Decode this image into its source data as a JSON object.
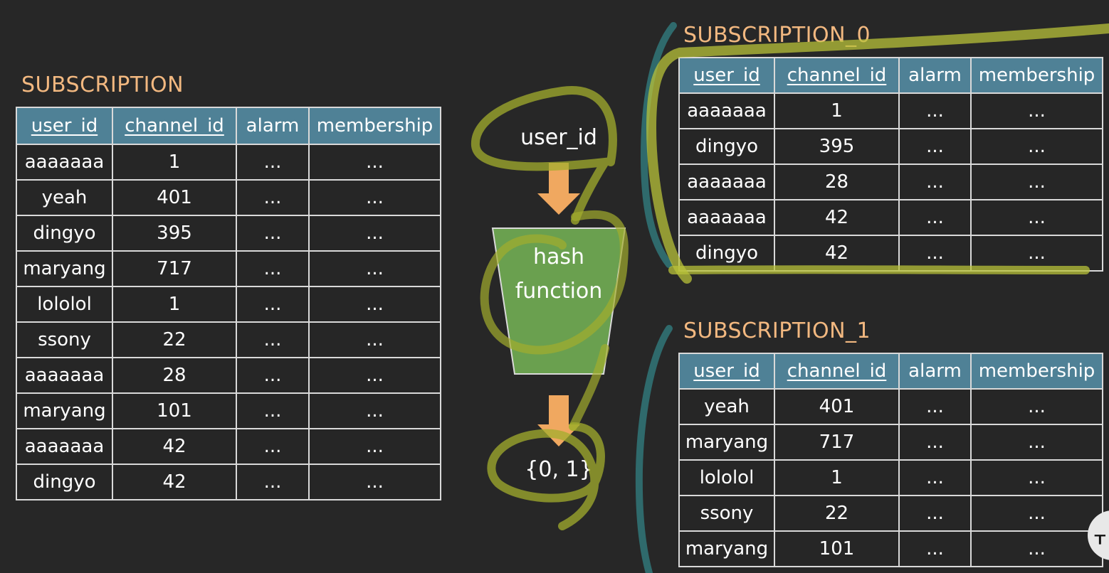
{
  "main": {
    "title": "SUBSCRIPTION",
    "headers": [
      "user_id",
      "channel_id",
      "alarm",
      "membership"
    ],
    "rows": [
      [
        "aaaaaaa",
        "1",
        "...",
        "..."
      ],
      [
        "yeah",
        "401",
        "...",
        "..."
      ],
      [
        "dingyo",
        "395",
        "...",
        "..."
      ],
      [
        "maryang",
        "717",
        "...",
        "..."
      ],
      [
        "lololol",
        "1",
        "...",
        "..."
      ],
      [
        "ssony",
        "22",
        "...",
        "..."
      ],
      [
        "aaaaaaa",
        "28",
        "...",
        "..."
      ],
      [
        "maryang",
        "101",
        "...",
        "..."
      ],
      [
        "aaaaaaa",
        "42",
        "...",
        "..."
      ],
      [
        "dingyo",
        "42",
        "...",
        "..."
      ]
    ]
  },
  "flow": {
    "input_label": "user_id",
    "hash_line1": "hash",
    "hash_line2": "function",
    "output_label": "{0, 1}"
  },
  "shard0": {
    "title": "SUBSCRIPTION_0",
    "headers": [
      "user_id",
      "channel_id",
      "alarm",
      "membership"
    ],
    "rows": [
      [
        "aaaaaaa",
        "1",
        "...",
        "..."
      ],
      [
        "dingyo",
        "395",
        "...",
        "..."
      ],
      [
        "aaaaaaa",
        "28",
        "...",
        "..."
      ],
      [
        "aaaaaaa",
        "42",
        "...",
        "..."
      ],
      [
        "dingyo",
        "42",
        "...",
        "..."
      ]
    ]
  },
  "shard1": {
    "title": "SUBSCRIPTION_1",
    "headers": [
      "user_id",
      "channel_id",
      "alarm",
      "membership"
    ],
    "rows": [
      [
        "yeah",
        "401",
        "...",
        "..."
      ],
      [
        "maryang",
        "717",
        "...",
        "..."
      ],
      [
        "lololol",
        "1",
        "...",
        "..."
      ],
      [
        "ssony",
        "22",
        "...",
        "..."
      ],
      [
        "maryang",
        "101",
        "...",
        "..."
      ]
    ]
  },
  "colors": {
    "background": "#272727",
    "table_title": "#f2b880",
    "header_fill": "#4f8196",
    "hash_box": "#6aa04f",
    "arrow": "#f0a860",
    "highlight_stroke": "#b8c23a",
    "teal_stroke": "#2f6e70"
  }
}
